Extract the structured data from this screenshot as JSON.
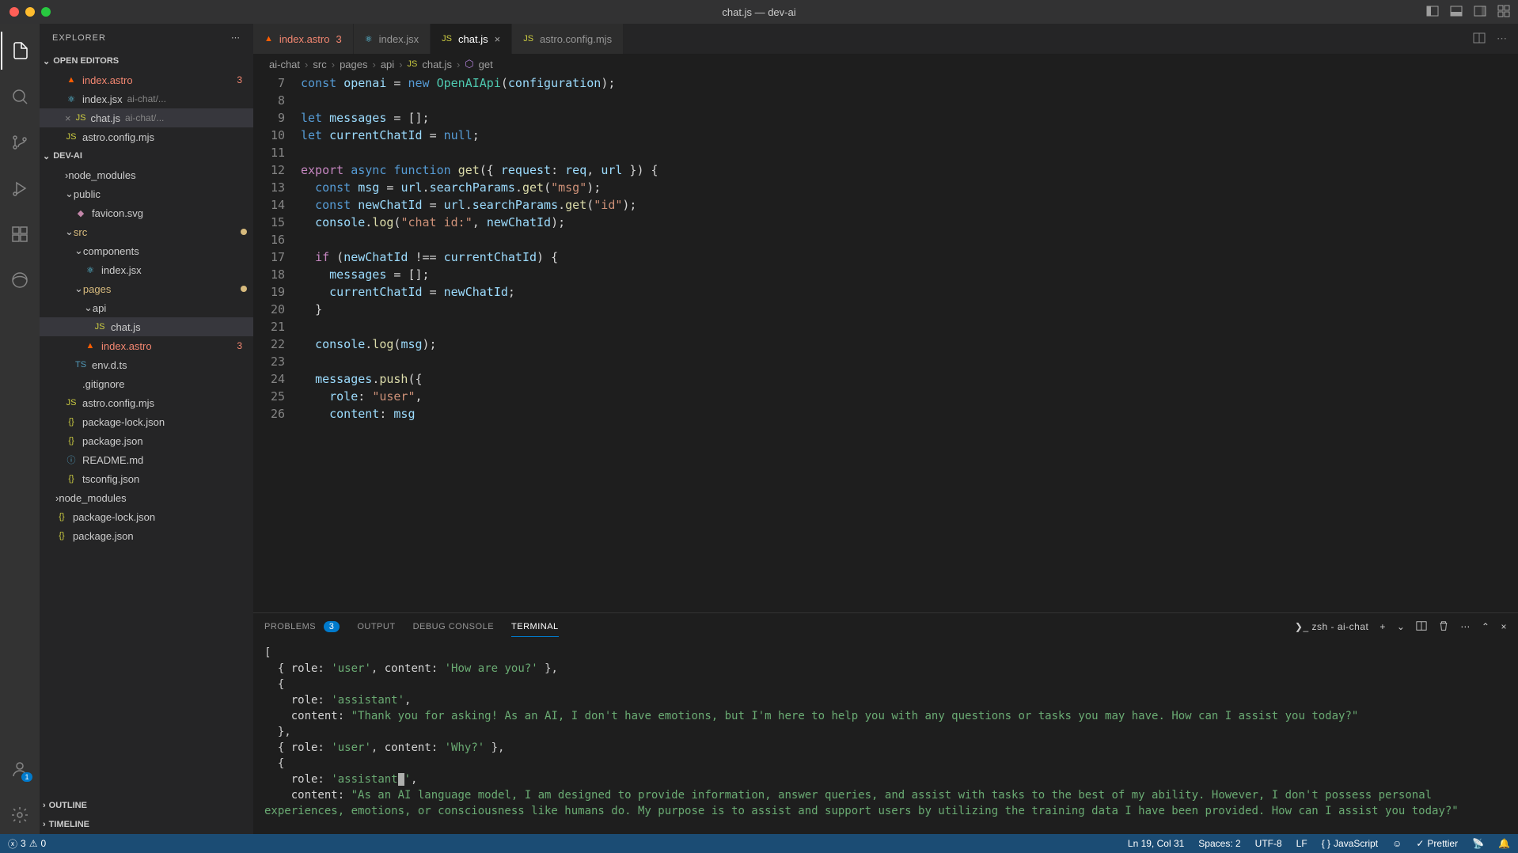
{
  "window": {
    "title": "chat.js — dev-ai"
  },
  "explorer": {
    "title": "EXPLORER",
    "openEditors": {
      "label": "OPEN EDITORS",
      "items": [
        {
          "name": "index.astro",
          "badge": "3",
          "icon": "astro"
        },
        {
          "name": "index.jsx",
          "hint": "ai-chat/...",
          "icon": "jsx"
        },
        {
          "name": "chat.js",
          "hint": "ai-chat/...",
          "icon": "js",
          "active": true
        },
        {
          "name": "astro.config.mjs",
          "icon": "js"
        }
      ]
    },
    "project": {
      "label": "DEV-AI",
      "tree": [
        {
          "label": "node_modules",
          "indent": 1,
          "type": "folder-cut"
        },
        {
          "label": "public",
          "indent": 1,
          "type": "folder",
          "open": true
        },
        {
          "label": "favicon.svg",
          "indent": 2,
          "type": "file",
          "icon": "svg"
        },
        {
          "label": "src",
          "indent": 1,
          "type": "folder",
          "open": true,
          "modified": true
        },
        {
          "label": "components",
          "indent": 2,
          "type": "folder",
          "open": true
        },
        {
          "label": "index.jsx",
          "indent": 3,
          "type": "file",
          "icon": "jsx"
        },
        {
          "label": "pages",
          "indent": 2,
          "type": "folder",
          "open": true,
          "modified": true
        },
        {
          "label": "api",
          "indent": 3,
          "type": "folder",
          "open": true
        },
        {
          "label": "chat.js",
          "indent": 4,
          "type": "file",
          "icon": "js",
          "selected": true
        },
        {
          "label": "index.astro",
          "indent": 3,
          "type": "file",
          "icon": "astro",
          "badge": "3"
        },
        {
          "label": "env.d.ts",
          "indent": 2,
          "type": "file",
          "icon": "ts"
        },
        {
          "label": ".gitignore",
          "indent": 1,
          "type": "file"
        },
        {
          "label": "astro.config.mjs",
          "indent": 1,
          "type": "file",
          "icon": "js"
        },
        {
          "label": "package-lock.json",
          "indent": 1,
          "type": "file",
          "icon": "json"
        },
        {
          "label": "package.json",
          "indent": 1,
          "type": "file",
          "icon": "json"
        },
        {
          "label": "README.md",
          "indent": 1,
          "type": "file",
          "icon": "md"
        },
        {
          "label": "tsconfig.json",
          "indent": 1,
          "type": "file",
          "icon": "json"
        },
        {
          "label": "node_modules",
          "indent": 0,
          "type": "folder"
        },
        {
          "label": "package-lock.json",
          "indent": 0,
          "type": "file",
          "icon": "json"
        },
        {
          "label": "package.json",
          "indent": 0,
          "type": "file",
          "icon": "json"
        }
      ]
    },
    "outline": "OUTLINE",
    "timeline": "TIMELINE"
  },
  "tabs": [
    {
      "name": "index.astro",
      "icon": "astro",
      "badge": "3"
    },
    {
      "name": "index.jsx",
      "icon": "jsx"
    },
    {
      "name": "chat.js",
      "icon": "js",
      "active": true,
      "closable": true
    },
    {
      "name": "astro.config.mjs",
      "icon": "js"
    }
  ],
  "breadcrumb": [
    "ai-chat",
    "src",
    "pages",
    "api",
    "chat.js",
    "get"
  ],
  "code": {
    "startLine": 7,
    "lines": [
      {
        "n": 7
      },
      {
        "n": 8
      },
      {
        "n": 9
      },
      {
        "n": 10
      },
      {
        "n": 11
      },
      {
        "n": 12
      },
      {
        "n": 13
      },
      {
        "n": 14
      },
      {
        "n": 15
      },
      {
        "n": 16
      },
      {
        "n": 17
      },
      {
        "n": 18
      },
      {
        "n": 19
      },
      {
        "n": 20
      },
      {
        "n": 21
      },
      {
        "n": 22
      },
      {
        "n": 23
      },
      {
        "n": 24
      },
      {
        "n": 25
      },
      {
        "n": 26
      }
    ]
  },
  "panel": {
    "tabs": {
      "problems": "PROBLEMS",
      "problemsCount": "3",
      "output": "OUTPUT",
      "debug": "DEBUG CONSOLE",
      "terminal": "TERMINAL"
    },
    "shell": "zsh - ai-chat",
    "terminal": {
      "l1": "[",
      "l2": "  { role: 'user', content: 'How are you?' },",
      "l3": "  {",
      "l4": "    role: 'assistant',",
      "l5": "    content: \"Thank you for asking! As an AI, I don't have emotions, but I'm here to help you with any questions or tasks you may have. How can I assist you today?\"",
      "l6": "  },",
      "l7": "  { role: 'user', content: 'Why?' },",
      "l8": "  {",
      "l9": "    role: 'assistant',",
      "l10": "    content: \"As an AI language model, I am designed to provide information, answer queries, and assist with tasks to the best of my ability. However, I don't possess personal experiences, emotions, or consciousness like humans do. My purpose is to assist and support users by utilizing the training data I have been provided. How can I assist you today?\""
    }
  },
  "status": {
    "errors": "3",
    "warnings": "0",
    "cursor": "Ln 19, Col 31",
    "spaces": "Spaces: 2",
    "encoding": "UTF-8",
    "eol": "LF",
    "lang": "JavaScript",
    "prettier": "Prettier"
  },
  "activity_badge": "1"
}
